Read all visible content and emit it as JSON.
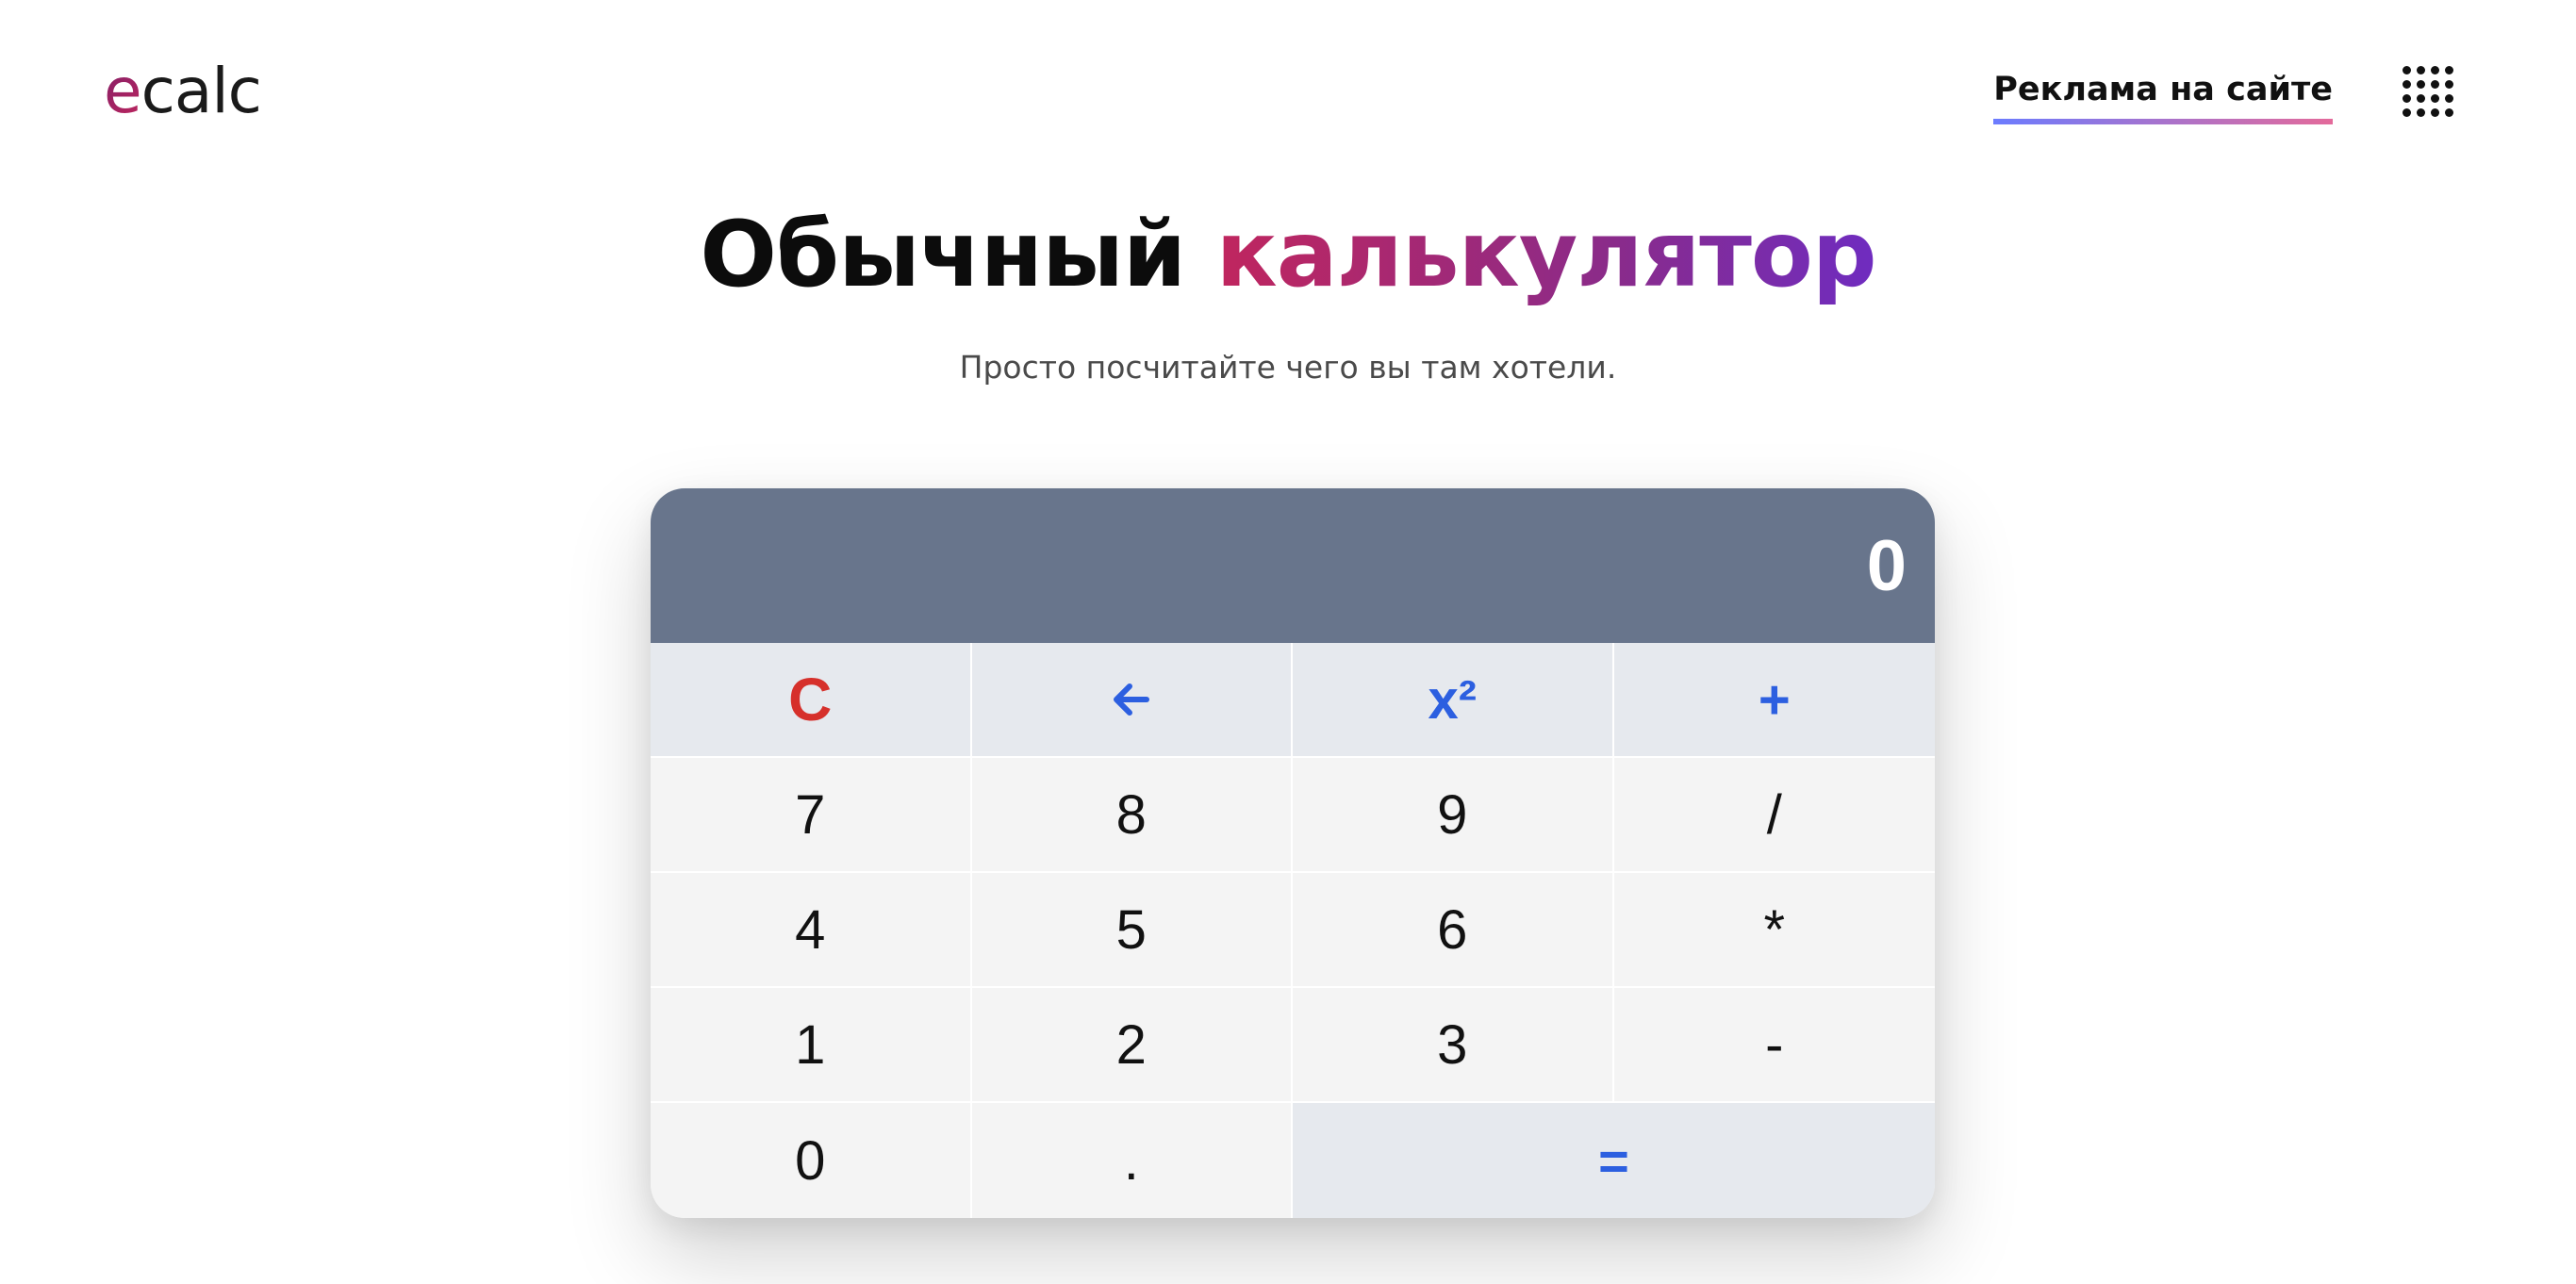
{
  "header": {
    "logo_first": "e",
    "logo_rest": "calc",
    "ad_link": "Реклама на сайте",
    "apps_icon": "grid-dots-icon"
  },
  "title": {
    "part1": "Обычный ",
    "part2": "калькулятор"
  },
  "subtitle": "Просто посчитайте чего вы там хотели.",
  "calculator": {
    "display": "0",
    "keys": {
      "clear": "C",
      "backspace_icon": "arrow-left-icon",
      "square": "x²",
      "plus": "+",
      "k7": "7",
      "k8": "8",
      "k9": "9",
      "divide": "/",
      "k4": "4",
      "k5": "5",
      "k6": "6",
      "multiply": "*",
      "k1": "1",
      "k2": "2",
      "k3": "3",
      "minus": "-",
      "k0": "0",
      "dot": ".",
      "equals": "="
    }
  },
  "colors": {
    "display_bg": "#68758c",
    "accent_blue": "#2c5fe0",
    "clear_red": "#d6302b",
    "title_gradient_start": "#c0265e",
    "title_gradient_end": "#6f2cc0"
  }
}
